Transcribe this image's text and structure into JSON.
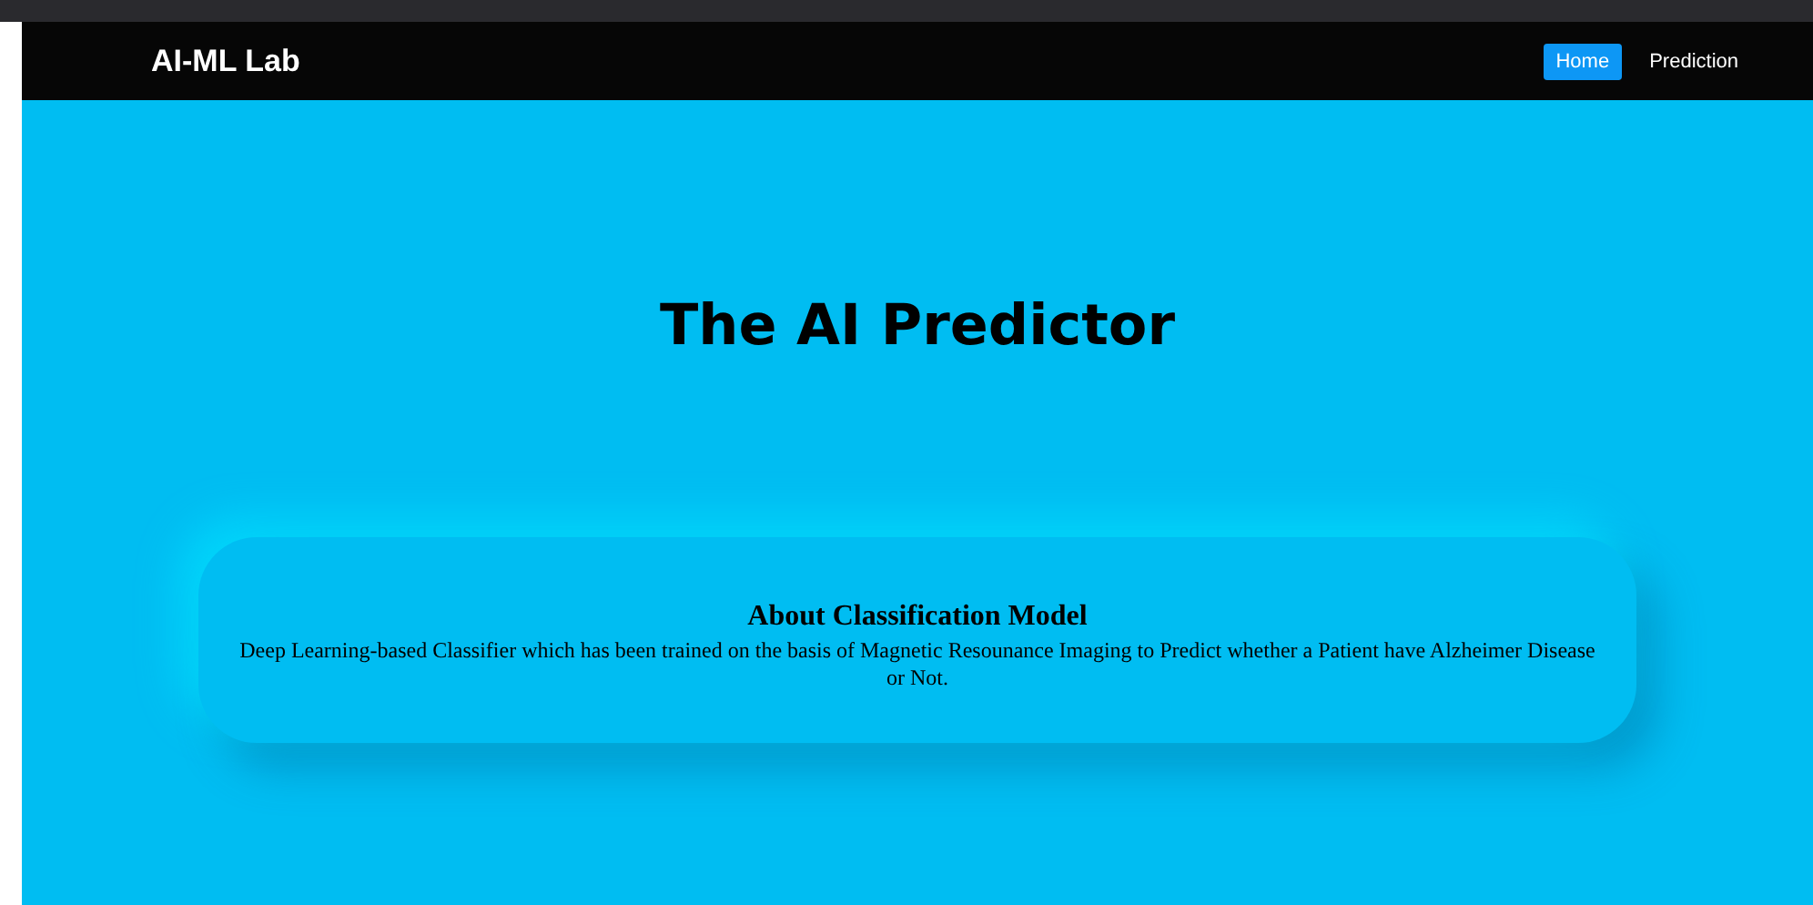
{
  "navbar": {
    "brand": "AI-ML Lab",
    "links": [
      {
        "label": "Home",
        "selected": true
      },
      {
        "label": "Prediction",
        "selected": false
      }
    ]
  },
  "hero": {
    "title": "The AI Predictor"
  },
  "card": {
    "title": "About Classification Model",
    "text": "Deep Learning-based Classifier which has been trained on the basis of Magnetic Resounance Imaging to Predict whether a Patient have Alzheimer Disease or Not."
  }
}
